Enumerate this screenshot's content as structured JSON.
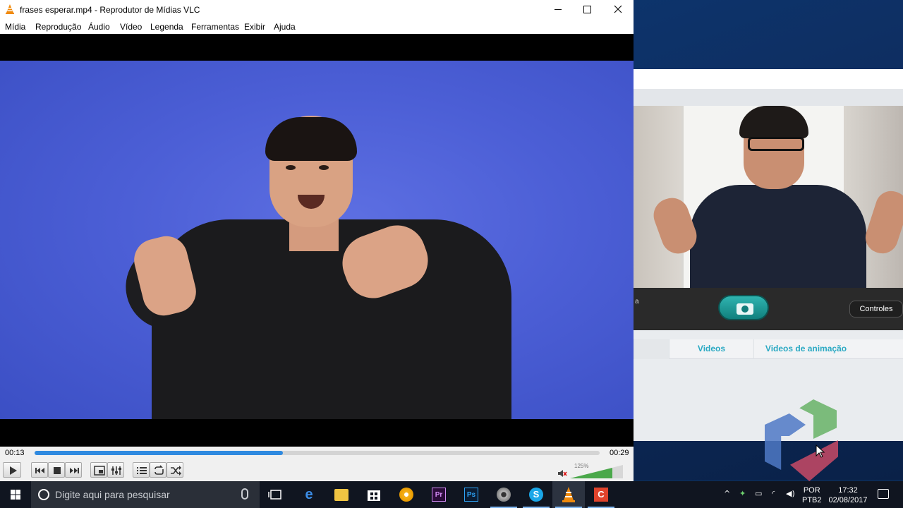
{
  "vlc": {
    "title": "frases esperar.mp4 - Reprodutor de Mídias VLC",
    "menu": [
      "Mídia",
      "Reprodução",
      "Áudio",
      "Vídeo",
      "Legenda",
      "Ferramentas",
      "Exibir",
      "Ajuda"
    ],
    "time_current": "00:13",
    "time_total": "00:29",
    "progress_fraction": 0.44,
    "volume_percent": "125%",
    "icons": {
      "play": "play-icon",
      "prev": "previous-icon",
      "stop": "stop-icon",
      "next": "next-icon",
      "fullscreen": "fullscreen-icon",
      "extended": "extended-settings-icon",
      "playlist": "playlist-icon",
      "loop": "loop-icon",
      "random": "random-icon",
      "mute": "mute-icon"
    },
    "accent": "#2f8ae0"
  },
  "camera_app": {
    "partial_label": "a",
    "controles_label": "Controles",
    "tabs": [
      "Videos",
      "Videos de animação"
    ],
    "tab_color": "#2aa9c3"
  },
  "taskbar": {
    "search_placeholder": "Digite aqui para pesquisar",
    "language": "POR",
    "keyboard": "PTB2",
    "time": "17:32",
    "date": "02/08/2017",
    "apps": [
      "task-view",
      "edge",
      "file-explorer",
      "store",
      "chrome-canary",
      "premiere",
      "photoshop",
      "webcam",
      "skype",
      "vlc",
      "camtasia"
    ]
  }
}
